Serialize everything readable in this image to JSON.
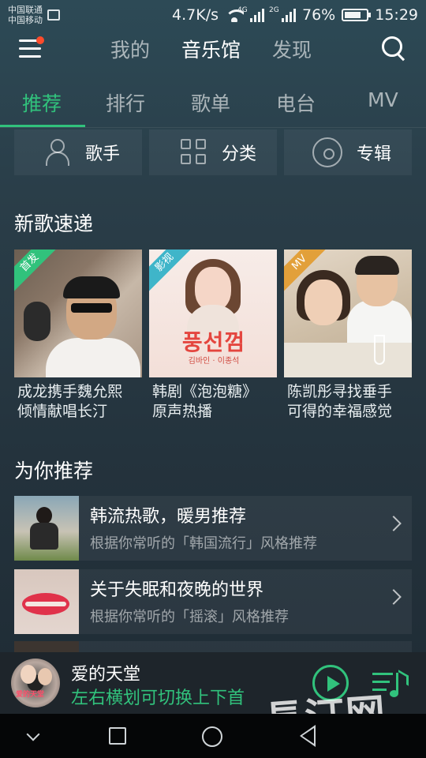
{
  "status_bar": {
    "carrier_1": "中国联通",
    "carrier_2": "中国移动",
    "net_speed": "4.7K/s",
    "sim1_type": "4G",
    "sim2_type": "2G",
    "battery": "76%",
    "battery_level": 0.76,
    "time": "15:29"
  },
  "header": {
    "tabs": [
      {
        "label": "我的"
      },
      {
        "label": "音乐馆"
      },
      {
        "label": "发现"
      }
    ],
    "active_tab": "音乐馆"
  },
  "sub_tabs": {
    "items": [
      {
        "label": "推荐"
      },
      {
        "label": "排行"
      },
      {
        "label": "歌单"
      },
      {
        "label": "电台"
      },
      {
        "label": "MV"
      }
    ],
    "active": "推荐"
  },
  "categories": [
    {
      "label": "歌手",
      "icon": "singer-icon"
    },
    {
      "label": "分类",
      "icon": "grid-icon"
    },
    {
      "label": "专辑",
      "icon": "disc-icon"
    }
  ],
  "new_songs": {
    "title": "新歌速递",
    "cards": [
      {
        "badge": "首发",
        "badge_color": "#31c27c",
        "title_line1": "成龙携手魏允熙",
        "title_line2": "倾情献唱长汀"
      },
      {
        "badge": "影视",
        "badge_color": "#3fb5c9",
        "title_line1": "韩剧《泡泡糖》",
        "title_line2": "原声热播",
        "cover_text": "풍선껌",
        "cover_subtext": "김바인 · 이종석"
      },
      {
        "badge": "MV",
        "badge_color": "#e2a03a",
        "title_line1": "陈凯彤寻找垂手",
        "title_line2": "可得的幸福感觉"
      }
    ]
  },
  "recommend": {
    "title": "为你推荐",
    "items": [
      {
        "title": "韩流热歌，暖男推荐",
        "subtitle": "根据你常听的「韩国流行」风格推荐"
      },
      {
        "title": "关于失眠和夜晚的世界",
        "subtitle": "根据你常听的「摇滚」风格推荐"
      }
    ]
  },
  "player": {
    "song": "爱的天堂",
    "hint": "左右横划可切换上下首",
    "disc_label": "爱的天堂"
  },
  "watermark": "長汀网",
  "colors": {
    "accent": "#31c27c",
    "notify_dot": "#ff4b2b"
  }
}
